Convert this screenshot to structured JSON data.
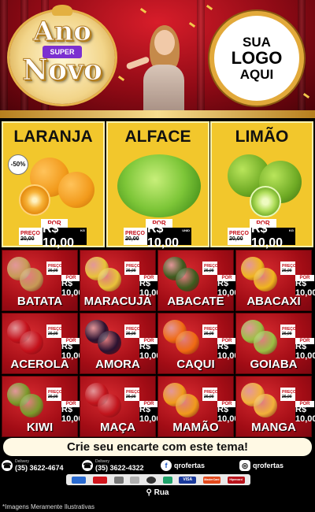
{
  "header": {
    "badge_line1": "Ano",
    "badge_super": "SUPER",
    "badge_line2": "Novo",
    "logo_line1": "SUA",
    "logo_line2": "LOGO",
    "logo_line3": "AQUI"
  },
  "price_labels": {
    "por": "POR",
    "preco": "PREÇO"
  },
  "featured": [
    {
      "name": "LARANJA",
      "discount": "-50%",
      "old_price": "20,00",
      "new_price": "R$ 10,00",
      "unit": "KG",
      "color": "#f29a1b"
    },
    {
      "name": "ALFACE",
      "old_price": "20,00",
      "new_price": "R$ 10,00",
      "unit": "UNID",
      "color": "#5fb02a"
    },
    {
      "name": "LIMÃO",
      "old_price": "20,00",
      "new_price": "R$ 10,00",
      "unit": "KG",
      "color": "#78b92d"
    }
  ],
  "products": [
    {
      "name": "BATATA",
      "old_price": "20,00",
      "new_price": "R$ 10,00",
      "unit": "KG",
      "color": "#c79a55"
    },
    {
      "name": "MARACUJÁ",
      "old_price": "20,00",
      "new_price": "R$ 10,00",
      "unit": "KG",
      "color": "#e8c23a"
    },
    {
      "name": "ABACATE",
      "old_price": "20,00",
      "new_price": "R$ 10,00",
      "unit": "KG",
      "color": "#3d5c1e"
    },
    {
      "name": "ABACAXI",
      "old_price": "20,00",
      "new_price": "R$ 10,00",
      "unit": "KG",
      "color": "#f0b51f"
    },
    {
      "name": "ACEROLA",
      "old_price": "20,00",
      "new_price": "R$ 10,00",
      "unit": "KG",
      "color": "#c4111b"
    },
    {
      "name": "AMORA",
      "old_price": "20,00",
      "new_price": "R$ 10,00",
      "unit": "KG",
      "color": "#2a1230"
    },
    {
      "name": "CAQUI",
      "old_price": "20,00",
      "new_price": "R$ 10,00",
      "unit": "KG",
      "color": "#ef6a12"
    },
    {
      "name": "GOIABA",
      "old_price": "20,00",
      "new_price": "R$ 10,00",
      "unit": "KG",
      "color": "#9bc044"
    },
    {
      "name": "KIWI",
      "old_price": "20,00",
      "new_price": "R$ 10,00",
      "unit": "KG",
      "color": "#7a9a2a"
    },
    {
      "name": "MAÇA",
      "old_price": "20,00",
      "new_price": "R$ 10,00",
      "unit": "KG",
      "color": "#c2141c"
    },
    {
      "name": "MAMÃO",
      "old_price": "20,00",
      "new_price": "R$ 10,00",
      "unit": "KG",
      "color": "#f09a1c"
    },
    {
      "name": "MANGA",
      "old_price": "20,00",
      "new_price": "R$ 10,00",
      "unit": "KG",
      "color": "#f2b13a"
    }
  ],
  "footer": {
    "cta": "Crie seu encarte com este tema!",
    "delivery_label": "Delivery",
    "phone1": "(35) 3622-4674",
    "phone2": "(35) 3622-4322",
    "facebook": "qrofertas",
    "instagram": "qrofertas",
    "payments": [
      "VISA",
      "MasterCard",
      "Hipercard"
    ],
    "address": "Rua",
    "disclaimer": "*Imagens Meramente Ilustrativas"
  },
  "icons": {
    "phone": "phone-icon",
    "facebook": "facebook-icon",
    "instagram": "instagram-icon",
    "location": "location-pin-icon"
  }
}
